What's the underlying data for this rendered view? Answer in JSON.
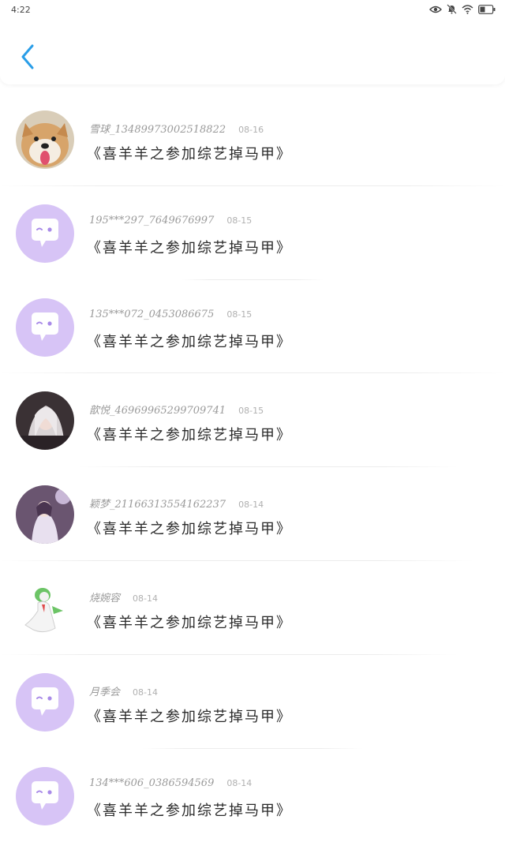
{
  "status": {
    "time": "4:22"
  },
  "header": {
    "back_icon": "chevron-left-icon",
    "accent": "#2a9ee8"
  },
  "comments": [
    {
      "username": "雪球_13489973002518822",
      "date": "08-16",
      "text": "《喜羊羊之参加综艺掉马甲》",
      "avatar": "dog-photo"
    },
    {
      "username": "195***297_7649676997",
      "date": "08-15",
      "text": "《喜羊羊之参加综艺掉马甲》",
      "avatar": "default-chat-avatar"
    },
    {
      "username": "135***072_0453086675",
      "date": "08-15",
      "text": "《喜羊羊之参加综艺掉马甲》",
      "avatar": "default-chat-avatar"
    },
    {
      "username": "歆悦_46969965299709741",
      "date": "08-15",
      "text": "《喜羊羊之参加综艺掉马甲》",
      "avatar": "anime-girl-dark"
    },
    {
      "username": "颖梦_21166313554162237",
      "date": "08-14",
      "text": "《喜羊羊之参加综艺掉马甲》",
      "avatar": "anime-girl-purple"
    },
    {
      "username": "烧婉容",
      "date": "08-14",
      "text": "《喜羊羊之参加综艺掉马甲》",
      "avatar": "gardevoir-figure"
    },
    {
      "username": "月季会",
      "date": "08-14",
      "text": "《喜羊羊之参加综艺掉马甲》",
      "avatar": "default-chat-avatar"
    },
    {
      "username": "134***606_0386594569",
      "date": "08-14",
      "text": "《喜羊羊之参加综艺掉马甲》",
      "avatar": "default-chat-avatar"
    }
  ],
  "colors": {
    "default_avatar_bg": "#d7c4f6",
    "default_avatar_fg": "#ffffff",
    "default_avatar_dot": "#a98be8"
  }
}
